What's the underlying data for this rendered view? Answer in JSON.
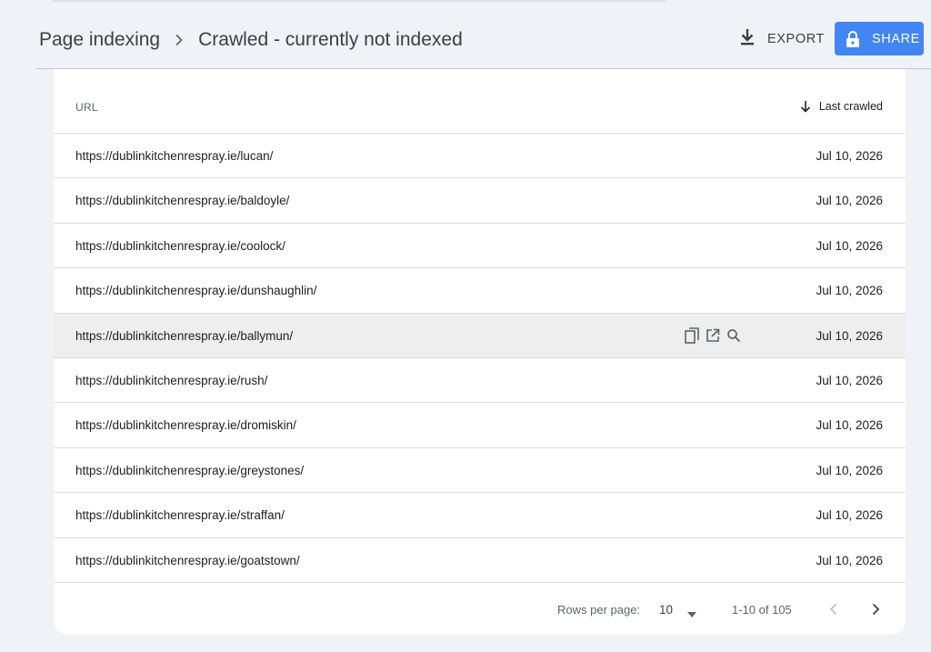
{
  "header": {
    "breadcrumb_parent": "Page indexing",
    "breadcrumb_current": "Crawled - currently not indexed",
    "export_label": "EXPORT",
    "share_label": "SHARE"
  },
  "colors": {
    "accent": "#4285f4",
    "background": "#eff3f8",
    "hover_row": "#eeeeee"
  },
  "table": {
    "columns": {
      "url": "URL",
      "last_crawled": "Last crawled"
    },
    "sort": "last_crawled-descending",
    "rows": [
      {
        "url": "https://dublinkitchenrespray.ie/lucan/",
        "date": "Jul 10, 2026"
      },
      {
        "url": "https://dublinkitchenrespray.ie/baldoyle/",
        "date": "Jul 10, 2026"
      },
      {
        "url": "https://dublinkitchenrespray.ie/coolock/",
        "date": "Jul 10, 2026"
      },
      {
        "url": "https://dublinkitchenrespray.ie/dunshaughlin/",
        "date": "Jul 10, 2026"
      },
      {
        "url": "https://dublinkitchenrespray.ie/ballymun/",
        "date": "Jul 10, 2026"
      },
      {
        "url": "https://dublinkitchenrespray.ie/rush/",
        "date": "Jul 10, 2026"
      },
      {
        "url": "https://dublinkitchenrespray.ie/dromiskin/",
        "date": "Jul 10, 2026"
      },
      {
        "url": "https://dublinkitchenrespray.ie/greystones/",
        "date": "Jul 10, 2026"
      },
      {
        "url": "https://dublinkitchenrespray.ie/straffan/",
        "date": "Jul 10, 2026"
      },
      {
        "url": "https://dublinkitchenrespray.ie/goatstown/",
        "date": "Jul 10, 2026"
      }
    ],
    "hover_row_index": 4,
    "row_actions": [
      "copy-icon",
      "open-in-new-icon",
      "inspect-url-icon"
    ]
  },
  "pagination": {
    "rows_per_page_label": "Rows per page:",
    "rows_per_page_value": "10",
    "range_label": "1-10 of 105"
  },
  "icons": {
    "breadcrumb_separator": "chevron-right-icon",
    "export": "download-icon",
    "share": "lock-icon",
    "sort": "arrow-down-icon",
    "prev": "chevron-left-icon",
    "next": "chevron-right-icon"
  }
}
